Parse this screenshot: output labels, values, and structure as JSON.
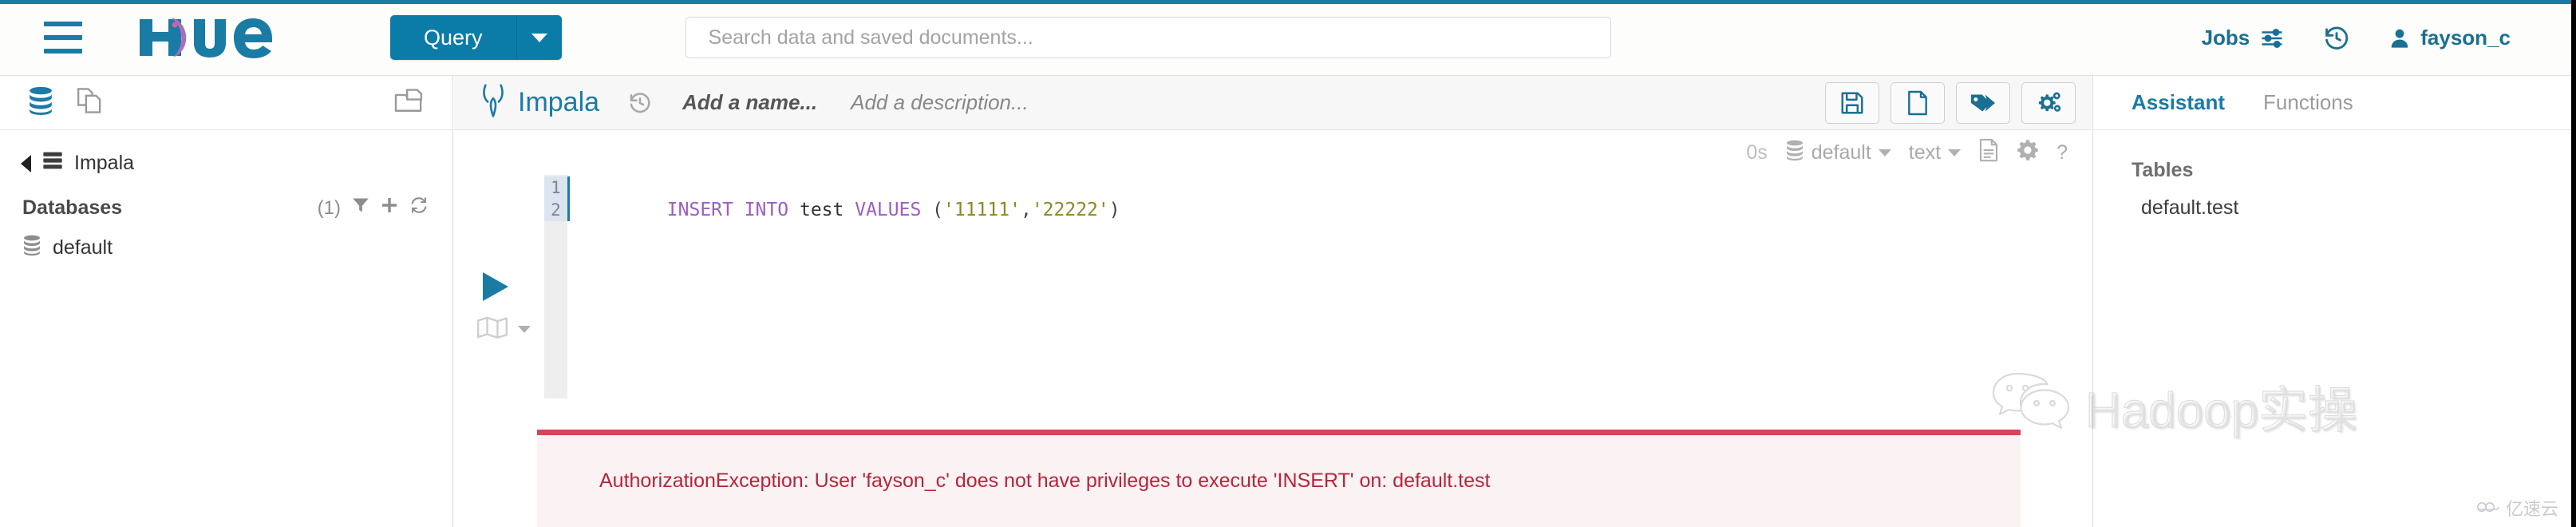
{
  "topnav": {
    "menu_icon": "hamburger-icon",
    "logo_text": "hue",
    "query_button": "Query",
    "query_caret": "chevron-down-icon",
    "search_placeholder": "Search data and saved documents...",
    "search_value": "",
    "jobs_label": "Jobs",
    "jobs_icon": "sliders-icon",
    "history_icon": "history-clock-icon",
    "user_icon": "user-icon",
    "username": "fayson_c"
  },
  "left_panel": {
    "head_icons": [
      "database-icon",
      "documents-icon"
    ],
    "import_icon": "folder-import-icon",
    "back_label": "Impala",
    "back_icon": "chevron-left-icon",
    "source_icon": "server-icon",
    "section_title": "Databases",
    "section_count": "(1)",
    "section_icons": [
      "filter-icon",
      "plus-icon",
      "refresh-icon"
    ],
    "items": [
      {
        "icon": "database-icon",
        "label": "default"
      }
    ]
  },
  "editor": {
    "engine_icon": "impala-icon",
    "engine_name": "Impala",
    "history_icon": "history-clock-icon",
    "name_placeholder": "Add a name...",
    "description_placeholder": "Add a description...",
    "toolbar_buttons": [
      {
        "name": "save-button",
        "icon": "floppy-disk-icon"
      },
      {
        "name": "new-document-button",
        "icon": "file-icon"
      },
      {
        "name": "tags-button",
        "icon": "tags-icon"
      },
      {
        "name": "settings-button",
        "icon": "gears-icon"
      }
    ],
    "subbar": {
      "duration": "0s",
      "database_icon": "database-icon",
      "database": "default",
      "format": "text",
      "result_icon": "file-lines-icon",
      "settings_icon": "gear-icon",
      "help_icon": "question-mark-icon"
    },
    "run_icon": "play-icon",
    "explain_icon": "map-icon",
    "explain_caret": "chevron-down-icon",
    "gutter_lines": [
      "1",
      "2"
    ],
    "code_tokens": [
      {
        "text": "INSERT INTO",
        "type": "keyword"
      },
      {
        "text": " ",
        "type": "plain"
      },
      {
        "text": "test",
        "type": "identifier"
      },
      {
        "text": " ",
        "type": "plain"
      },
      {
        "text": "VALUES",
        "type": "keyword"
      },
      {
        "text": " (",
        "type": "plain"
      },
      {
        "text": "'11111'",
        "type": "string"
      },
      {
        "text": ",",
        "type": "plain"
      },
      {
        "text": "'22222'",
        "type": "string"
      },
      {
        "text": ")",
        "type": "plain"
      }
    ]
  },
  "error": {
    "message": "AuthorizationException: User 'fayson_c' does not have privileges to execute 'INSERT' on: default.test"
  },
  "right_panel": {
    "tabs": [
      {
        "label": "Assistant",
        "active": true
      },
      {
        "label": "Functions",
        "active": false
      }
    ],
    "tables_label": "Tables",
    "tables": [
      "default.test"
    ]
  },
  "watermarks": {
    "main_icon": "wechat-icon",
    "main_text": "Hadoop实操",
    "corner_icon": "cloud-icon",
    "corner_text": "亿速云"
  },
  "colors": {
    "brand_blue": "#1a7ba5",
    "button_blue": "#0b7ca8",
    "error_red": "#b6253a",
    "error_border": "#d9435c",
    "error_bg": "#fbf2f3",
    "keyword_purple": "#9b5ec0",
    "string_olive": "#8a8a23"
  }
}
